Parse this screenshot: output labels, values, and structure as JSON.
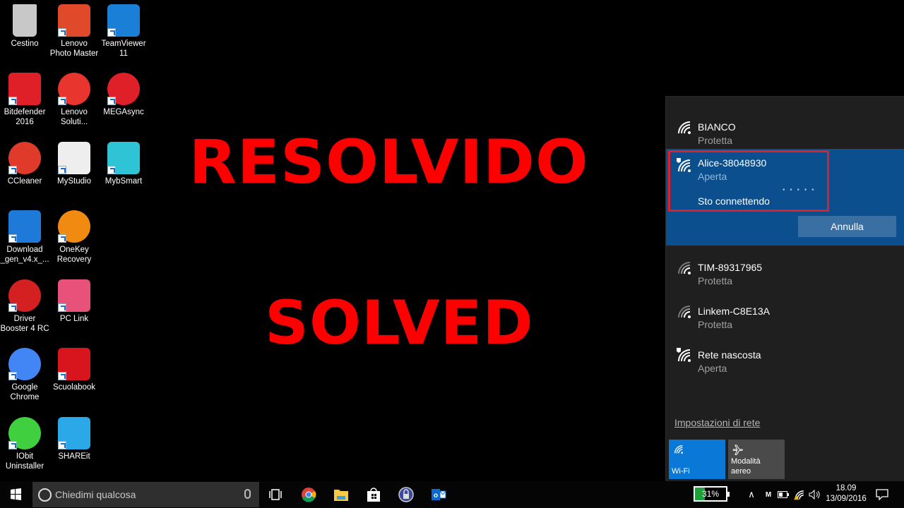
{
  "desktop": {
    "icons": [
      {
        "label": "Cestino",
        "icon": "recycle-bin-icon",
        "color": "#c8c8c8"
      },
      {
        "label": "Lenovo\nPhoto Master",
        "icon": "lenovo-photo-master-icon",
        "color": "#e0492a"
      },
      {
        "label": "TeamViewer\n11",
        "icon": "teamviewer-icon",
        "color": "#1a7fd6"
      },
      {
        "label": "Bitdefender\n2016",
        "icon": "bitdefender-icon",
        "color": "#e02028"
      },
      {
        "label": "Lenovo\nSoluti...",
        "icon": "lenovo-solution-center-icon",
        "color": "#e8362e"
      },
      {
        "label": "MEGAsync",
        "icon": "megasync-icon",
        "color": "#e02028"
      },
      {
        "label": "CCleaner",
        "icon": "ccleaner-icon",
        "color": "#e03a2a"
      },
      {
        "label": "MyStudio",
        "icon": "mystudio-icon",
        "color": "#eeeeee"
      },
      {
        "label": "MybSmart",
        "icon": "mybsmart-icon",
        "color": "#2ec4d6"
      },
      {
        "label": "Download\n_gen_v4.x_...",
        "icon": "download-app-icon",
        "color": "#1e7ad8"
      },
      {
        "label": "OneKey\nRecovery",
        "icon": "onekey-recovery-icon",
        "color": "#f08a10"
      },
      {
        "label": "Driver\nBooster 4 RC",
        "icon": "driver-booster-icon",
        "color": "#d42020"
      },
      {
        "label": "PC Link",
        "icon": "pc-link-icon",
        "color": "#e8527a"
      },
      {
        "label": "Google\nChrome",
        "icon": "chrome-icon",
        "color": "#4285f4"
      },
      {
        "label": "Scuolabook",
        "icon": "scuolabook-icon",
        "color": "#d8141c"
      },
      {
        "label": "IObit\nUninstaller",
        "icon": "iobit-uninstaller-icon",
        "color": "#3fcf3f"
      },
      {
        "label": "SHAREit",
        "icon": "shareit-icon",
        "color": "#2aa8e8"
      }
    ]
  },
  "overlay": {
    "line1": "RESOLVIDO",
    "line2": "SOLVED",
    "color": "#ff0000"
  },
  "network_flyout": {
    "networks": [
      {
        "name": "BIANCO",
        "status": "Protetta",
        "icon": "wifi-icon"
      },
      {
        "name": "Alice-38048930",
        "status": "Aperta",
        "icon": "wifi-open-warning-icon",
        "state": "Sto connettendo",
        "progress_dots": "• • • • •",
        "cancel_label": "Annulla"
      },
      {
        "name": "TIM-89317965",
        "status": "Protetta",
        "icon": "wifi-weak-icon"
      },
      {
        "name": "Linkem-C8E13A",
        "status": "Protetta",
        "icon": "wifi-weak-icon"
      },
      {
        "name": "Rete nascosta",
        "status": "Aperta",
        "icon": "wifi-open-warning-icon"
      }
    ],
    "settings_link": "Impostazioni di rete",
    "quick_actions": [
      {
        "label": "Wi-Fi",
        "icon": "wifi-icon",
        "active": true
      },
      {
        "label": "Modalità\naereo",
        "icon": "airplane-icon",
        "active": false
      }
    ],
    "accent": "#0b4f8e",
    "highlight_border": "#e01f2a"
  },
  "taskbar": {
    "search_placeholder": "Chiedimi qualcosa",
    "pinned": [
      "task-view-icon",
      "chrome-icon",
      "file-explorer-icon",
      "store-icon",
      "keepass-icon",
      "outlook-icon"
    ],
    "battery_label": "31%",
    "battery_percent": 31,
    "time": "18.09",
    "date": "13/09/2016"
  }
}
